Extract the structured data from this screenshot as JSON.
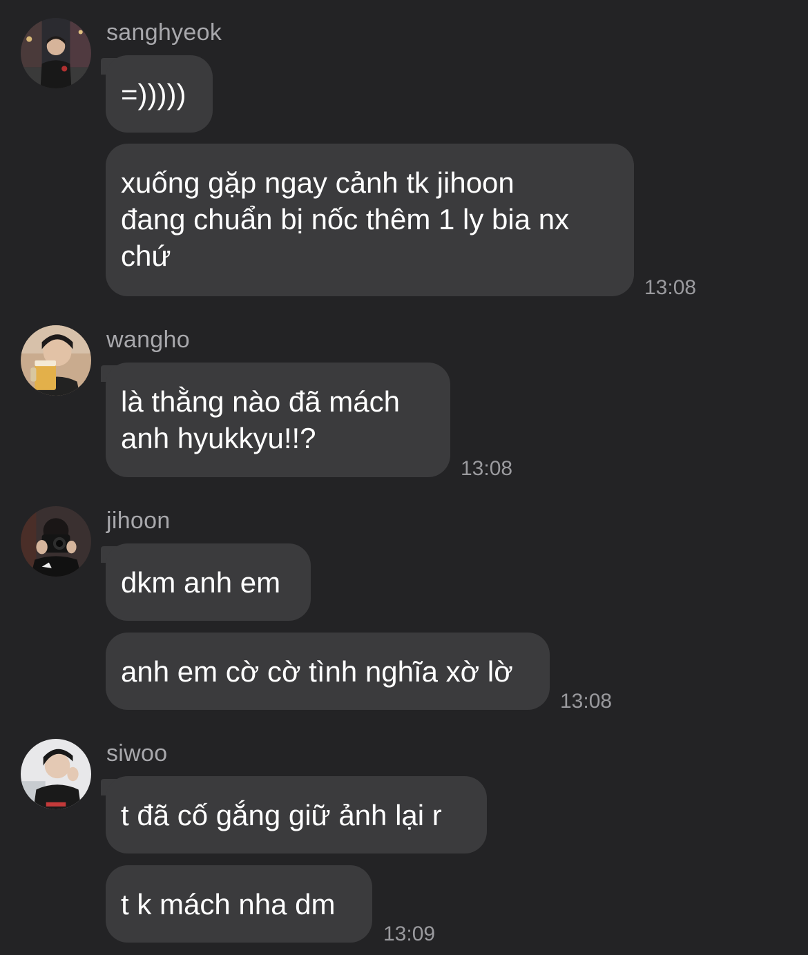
{
  "groups": [
    {
      "sender": "sanghyeok",
      "avatar": "avatar-photo-sanghyeok",
      "messages": [
        "=)))))",
        "xuống gặp ngay cảnh tk jihoon\nđang chuẩn bị nốc thêm 1 ly bia nx\nchứ"
      ],
      "time": "13:08"
    },
    {
      "sender": "wangho",
      "avatar": "avatar-photo-wangho",
      "messages": [
        "là thằng nào đã mách\nanh hyukkyu!!?"
      ],
      "time": "13:08"
    },
    {
      "sender": "jihoon",
      "avatar": "avatar-photo-jihoon",
      "messages": [
        "dkm anh em",
        "anh em cờ cờ tình nghĩa xờ lờ"
      ],
      "time": "13:08"
    },
    {
      "sender": "siwoo",
      "avatar": "avatar-photo-siwoo",
      "messages": [
        "t đã cố gắng giữ ảnh lại r",
        "t k mách nha dm"
      ],
      "time": "13:09"
    }
  ]
}
